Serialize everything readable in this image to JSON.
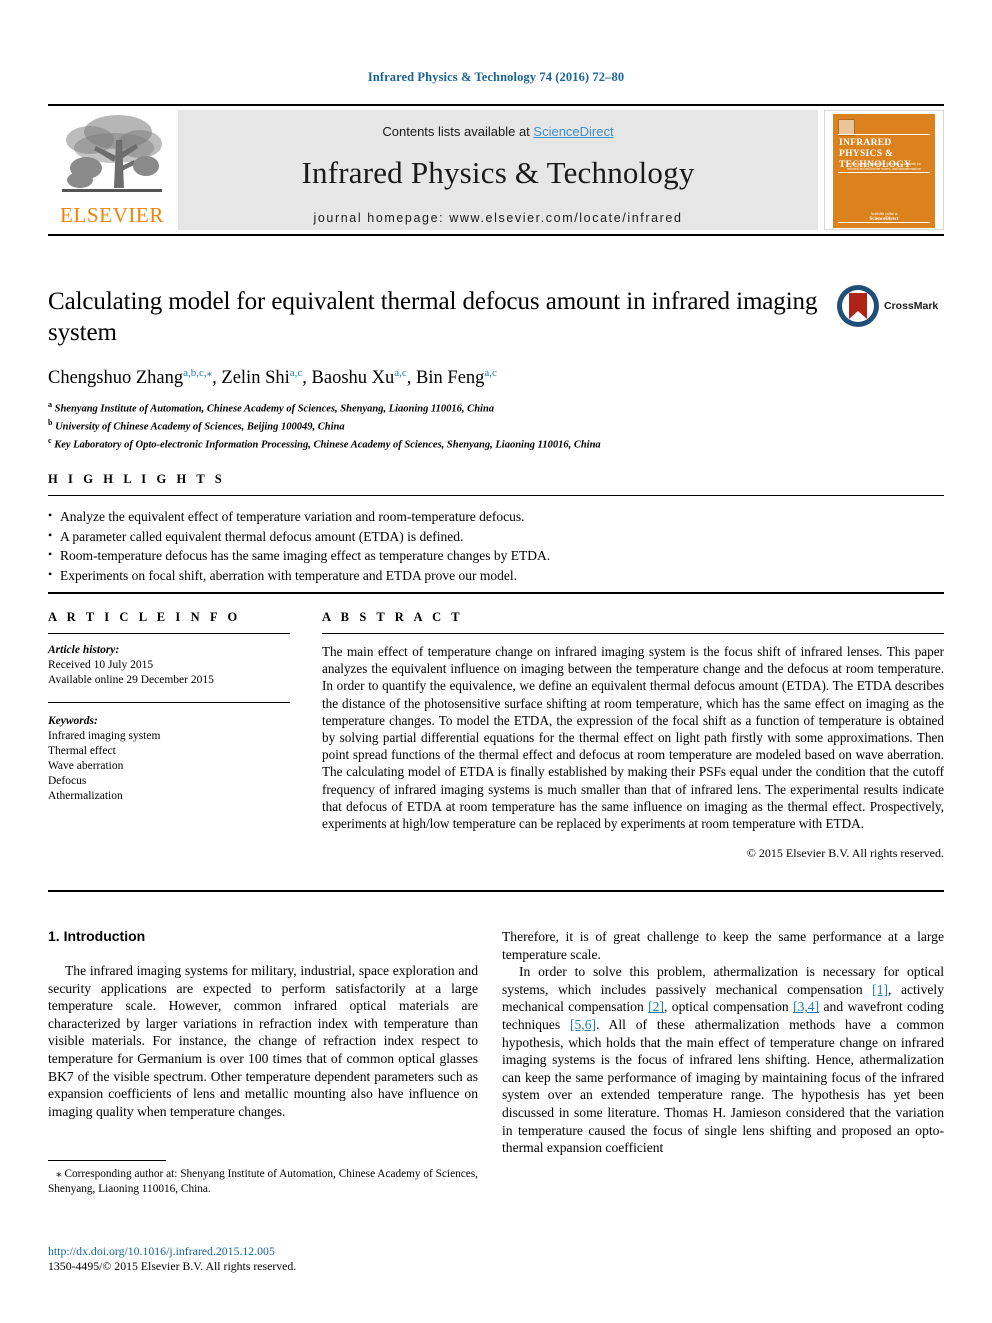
{
  "running_head": "Infrared Physics & Technology 74 (2016) 72–80",
  "masthead": {
    "contents_prefix": "Contents lists available at ",
    "sciencedirect": "ScienceDirect",
    "journal_title": "Infrared Physics & Technology",
    "homepage": "journal homepage: www.elsevier.com/locate/infrared",
    "publisher_wordmark": "ELSEVIER",
    "cover": {
      "title": "INFRARED PHYSICS & TECHNOLOGY",
      "subtitle": "an international journal for the study of infrared, far infrared and millimeter waves, and instrumentation",
      "footer_label": "Available online at",
      "footer_brand": "ScienceDirect"
    },
    "colors": {
      "elsevier_orange": "#F08300",
      "band_gray": "#e6e6e6",
      "sciencedirect_blue": "#3f8fc9",
      "cover_orange": "#D9821E"
    }
  },
  "crossmark": {
    "label": "CrossMark",
    "ring_color": "#1f4e79",
    "ribbon_color": "#b02418"
  },
  "article": {
    "title": "Calculating model for equivalent thermal defocus amount in infrared imaging system",
    "authors": [
      {
        "name": "Chengshuo Zhang",
        "marks": "a,b,c,⁎"
      },
      {
        "name": "Zelin Shi",
        "marks": "a,c"
      },
      {
        "name": "Baoshu Xu",
        "marks": "a,c"
      },
      {
        "name": "Bin Feng",
        "marks": "a,c"
      }
    ],
    "affiliations": [
      {
        "mark": "a",
        "text": "Shenyang Institute of Automation, Chinese Academy of Sciences, Shenyang, Liaoning 110016, China"
      },
      {
        "mark": "b",
        "text": "University of Chinese Academy of Sciences, Beijing 100049, China"
      },
      {
        "mark": "c",
        "text": "Key Laboratory of Opto-electronic Information Processing, Chinese Academy of Sciences, Shenyang, Liaoning 110016, China"
      }
    ]
  },
  "highlights": {
    "label": "H I G H L I G H T S",
    "items": [
      "Analyze the equivalent effect of temperature variation and room-temperature defocus.",
      "A parameter called equivalent thermal defocus amount (ETDA) is defined.",
      "Room-temperature defocus has the same imaging effect as temperature changes by ETDA.",
      "Experiments on focal shift, aberration with temperature and ETDA prove our model."
    ]
  },
  "article_info": {
    "label": "A R T I C L E  I N F O",
    "history_label": "Article history:",
    "received": "Received 10 July 2015",
    "available_online": "Available online 29 December 2015",
    "keywords_label": "Keywords:",
    "keywords": [
      "Infrared imaging system",
      "Thermal effect",
      "Wave aberration",
      "Defocus",
      "Athermalization"
    ]
  },
  "abstract": {
    "label": "A B S T R A C T",
    "text": "The main effect of temperature change on infrared imaging system is the focus shift of infrared lenses. This paper analyzes the equivalent influence on imaging between the temperature change and the defocus at room temperature. In order to quantify the equivalence, we define an equivalent thermal defocus amount (ETDA). The ETDA describes the distance of the photosensitive surface shifting at room temperature, which has the same effect on imaging as the temperature changes. To model the ETDA, the expression of the focal shift as a function of temperature is obtained by solving partial differential equations for the thermal effect on light path firstly with some approximations. Then point spread functions of the thermal effect and defocus at room temperature are modeled based on wave aberration. The calculating model of ETDA is finally established by making their PSFs equal under the condition that the cutoff frequency of infrared imaging systems is much smaller than that of infrared lens. The experimental results indicate that defocus of ETDA at room temperature has the same influence on imaging as the thermal effect. Prospectively, experiments at high/low temperature can be replaced by experiments at room temperature with ETDA.",
    "copyright": "© 2015 Elsevier B.V. All rights reserved."
  },
  "introduction": {
    "heading": "1. Introduction",
    "left_paragraph": "The infrared imaging systems for military, industrial, space exploration and security applications are expected to perform satisfactorily at a large temperature scale. However, common infrared optical materials are characterized by larger variations in refraction index with temperature than visible materials. For instance, the change of refraction index respect to temperature for Germanium is over 100 times that of common optical glasses BK7 of the visible spectrum. Other temperature dependent parameters such as expansion coefficients of lens and metallic mounting also have influence on imaging quality when temperature changes.",
    "right_paragraph_1": "Therefore, it is of great challenge to keep the same performance at a large temperature scale.",
    "right_paragraph_2_a": "In order to solve this problem, athermalization is necessary for optical systems, which includes passively mechanical compensation ",
    "cite_1": "[1]",
    "right_paragraph_2_b": ", actively mechanical compensation ",
    "cite_2": "[2]",
    "right_paragraph_2_c": ", optical compensation ",
    "cite_3": "[3,4]",
    "right_paragraph_2_d": " and wavefront coding techniques ",
    "cite_4": "[5,6]",
    "right_paragraph_2_e": ". All of these athermalization methods have a common hypothesis, which holds that the main effect of temperature change on infrared imaging systems is the focus of infrared lens shifting. Hence, athermalization can keep the same performance of imaging by maintaining focus of the infrared system over an extended temperature range. The hypothesis has yet been discussed in some literature. Thomas H. Jamieson considered that the variation in temperature caused the focus of single lens shifting and proposed an opto-thermal expansion coefficient"
  },
  "footnote": {
    "text": "⁎ Corresponding author at: Shenyang Institute of Automation, Chinese Academy of Sciences, Shenyang, Liaoning 110016, China."
  },
  "doi": {
    "url": "http://dx.doi.org/10.1016/j.infrared.2015.12.005",
    "issn_line": "1350-4495/© 2015 Elsevier B.V. All rights reserved."
  }
}
